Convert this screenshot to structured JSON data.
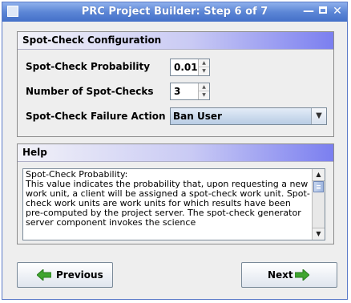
{
  "window": {
    "title": "PRC Project Builder: Step 6 of 7",
    "controls": {
      "minimize": "—",
      "close": "✕"
    }
  },
  "config": {
    "header": "Spot-Check Configuration",
    "probability_label": "Spot-Check Probability",
    "probability_value": "0.01",
    "count_label": "Number of Spot-Checks",
    "count_value": "3",
    "failure_label": "Spot-Check Failure Action",
    "failure_value": "Ban User"
  },
  "help": {
    "header": "Help",
    "text": "Spot-Check Probability:\nThis value indicates the probability that, upon requesting a new work unit, a client will be assigned a spot-check work unit.  Spot-check work units are work units for which results have been pre-computed by the project server.  The spot-check generator server component invokes the science"
  },
  "nav": {
    "previous": "Previous",
    "next": "Next"
  },
  "icons": {
    "arrow_color": "#3fa52f"
  }
}
